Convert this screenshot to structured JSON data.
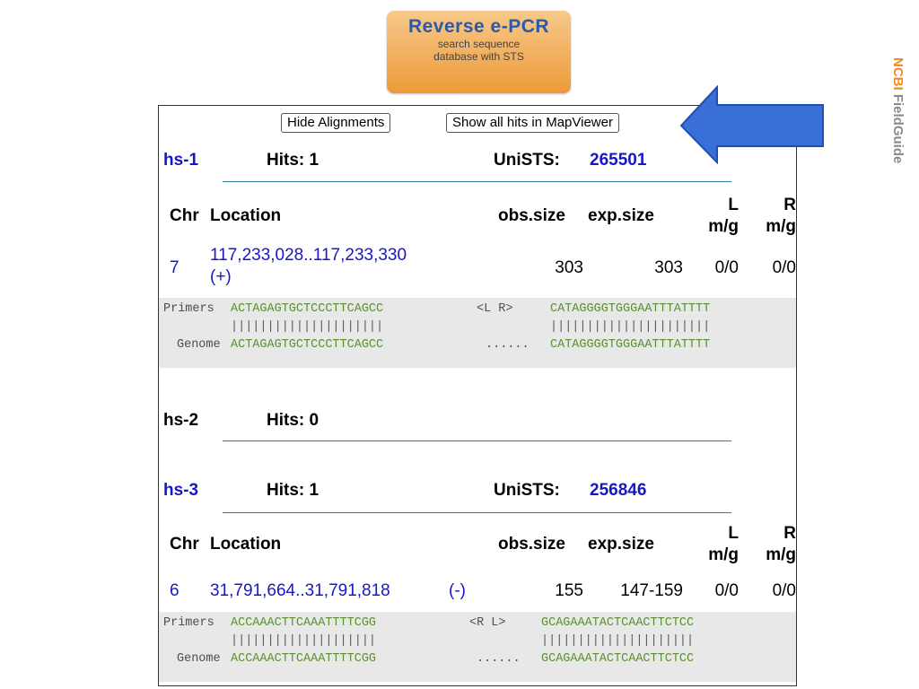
{
  "banner": {
    "title": "Reverse e-PCR",
    "subtitle_line1": "search sequence",
    "subtitle_line2": "database with STS"
  },
  "sidebar_brand": {
    "ncbi": "NCBI",
    "fieldguide": "FieldGuide"
  },
  "toolbar": {
    "hide_alignments": "Hide Alignments",
    "show_mapviewer": "Show all hits in MapViewer"
  },
  "col_headers": {
    "chr": "Chr",
    "location": "Location",
    "obs": "obs.size",
    "exp": "exp.size",
    "l": "L",
    "r": "R",
    "mg": "m/g"
  },
  "results": [
    {
      "name": "hs-1",
      "hits": "Hits: 1",
      "unists_label": "UniSTS:",
      "unists_id": "265501",
      "row": {
        "chr": "7",
        "loc1": "117,233,028..117,233,330",
        "loc2": "(+)",
        "obs": "303",
        "exp": "303",
        "l": "0/0",
        "r": "0/0"
      },
      "align": {
        "label1": "Primers",
        "p_left": "ACTAGAGTGCTCCCTTCAGCC",
        "mid": "<L R>",
        "p_right": "CATAGGGGTGGGAATTTATTTT",
        "bars_left": "|||||||||||||||||||||",
        "bars_right": "||||||||||||||||||||||",
        "label2": "Genome",
        "g_left": "ACTAGAGTGCTCCCTTCAGCC",
        "dots": "......",
        "g_right": "CATAGGGGTGGGAATTTATTTT"
      }
    },
    {
      "name": "hs-2",
      "hits": "Hits: 0"
    },
    {
      "name": "hs-3",
      "hits": "Hits: 1",
      "unists_label": "UniSTS:",
      "unists_id": "256846",
      "row": {
        "chr": "6",
        "loc1": "31,791,664..31,791,818",
        "loc2": "(-)",
        "obs": "155",
        "exp": "147-159",
        "l": "0/0",
        "r": "0/0"
      },
      "align": {
        "label1": "Primers",
        "p_left": "ACCAAACTTCAAATTTTCGG",
        "mid": "<R L>",
        "p_right": "GCAGAAATACTCAACTTCTCC",
        "bars_left": "||||||||||||||||||||",
        "bars_right": "|||||||||||||||||||||",
        "label2": "Genome",
        "g_left": "ACCAAACTTCAAATTTTCGG",
        "dots": "......",
        "g_right": "GCAGAAATACTCAACTTCTCC"
      }
    }
  ]
}
